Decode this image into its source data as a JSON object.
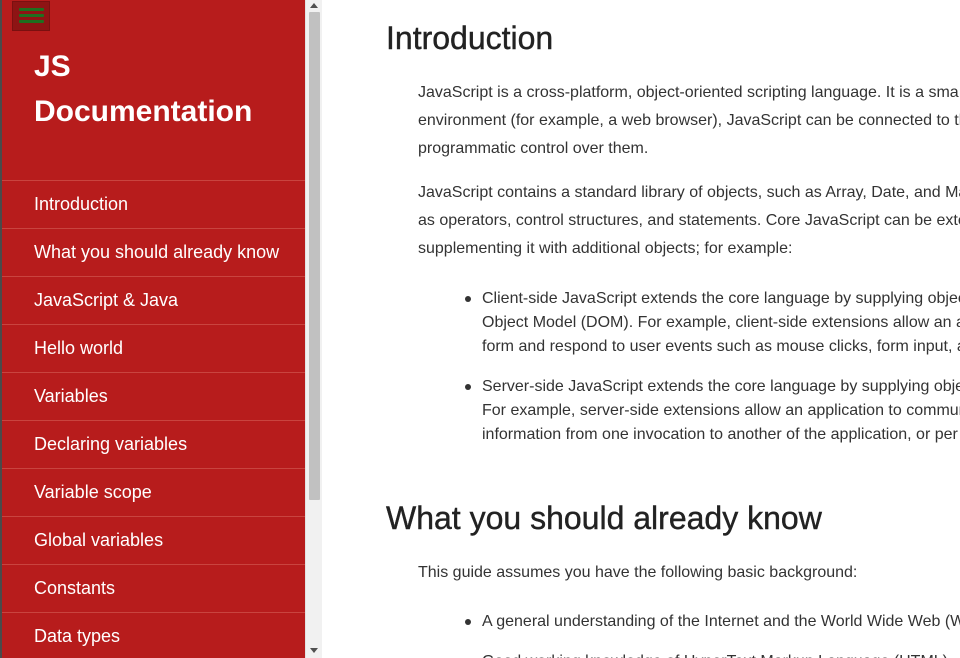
{
  "sidebar": {
    "menu_icon": "hamburger-menu-icon",
    "title": "JS Documentation",
    "title_lines": [
      "JS",
      "Documentation"
    ],
    "background_color": "#b71c1c",
    "items": [
      {
        "label": "Introduction"
      },
      {
        "label": "What you should already know"
      },
      {
        "label": "JavaScript & Java"
      },
      {
        "label": "Hello world"
      },
      {
        "label": "Variables"
      },
      {
        "label": "Declaring variables"
      },
      {
        "label": "Variable scope"
      },
      {
        "label": "Global variables"
      },
      {
        "label": "Constants"
      },
      {
        "label": "Data types"
      }
    ]
  },
  "main": {
    "sections": [
      {
        "heading": "Introduction",
        "paragraphs": [
          {
            "lines": [
              "JavaScript is a cross-platform, object-oriented scripting language. It is a sma",
              "environment (for example, a web browser), JavaScript can be connected to th",
              "programmatic control over them."
            ]
          },
          {
            "lines": [
              "JavaScript contains a standard library of objects, such as Array, Date, and Ma",
              "as operators, control structures, and statements. Core JavaScript can be exte",
              "supplementing it with additional objects; for example:"
            ]
          }
        ],
        "bullets": [
          {
            "lines": [
              "Client-side JavaScript extends the core language by supplying objec",
              "Object Model (DOM). For example, client-side extensions allow an a",
              "form and respond to user events such as mouse clicks, form input, a"
            ]
          },
          {
            "lines": [
              "Server-side JavaScript extends the core language by supplying objec",
              "For example, server-side extensions allow an application to commur",
              "information from one invocation to another of the application, or per"
            ]
          }
        ]
      },
      {
        "heading": "What you should already know",
        "paragraphs": [
          {
            "lines": [
              "This guide assumes you have the following basic background:"
            ]
          }
        ],
        "bullets": [
          {
            "lines": [
              "A general understanding of the Internet and the World Wide Web (W"
            ]
          },
          {
            "lines": [
              "Good working knowledge of HyperText Markup Language (HTML)"
            ]
          }
        ]
      }
    ]
  }
}
